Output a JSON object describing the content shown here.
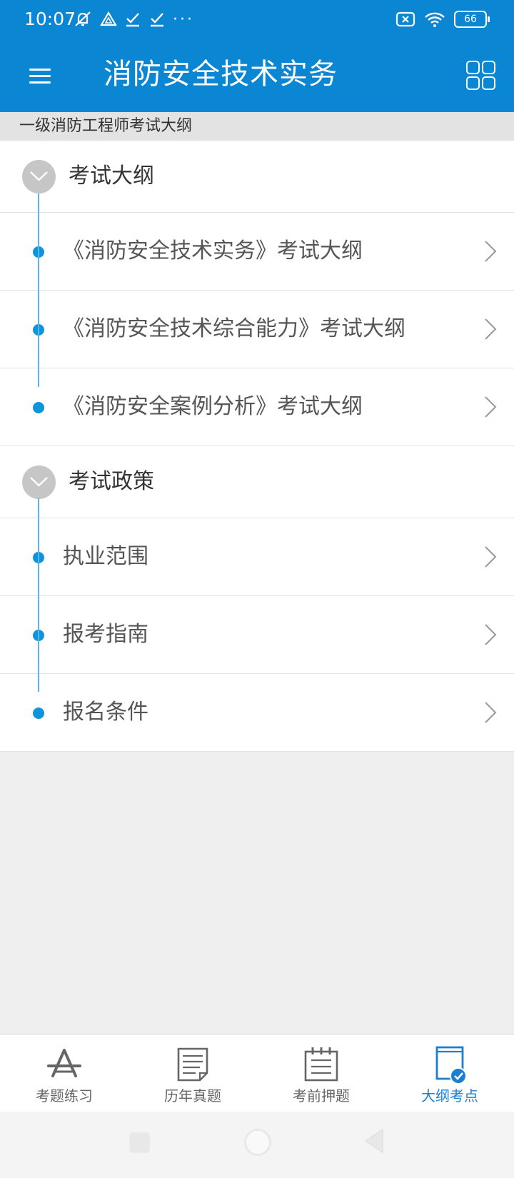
{
  "status_bar": {
    "time": "10:07",
    "battery": "66",
    "overflow": "···"
  },
  "app_bar": {
    "title": "消防安全技术实务"
  },
  "subheader": {
    "text": "一级消防工程师考试大纲"
  },
  "sections": [
    {
      "title": "考试大纲",
      "items": [
        "《消防安全技术实务》考试大纲",
        "《消防安全技术综合能力》考试大纲",
        "《消防安全案例分析》考试大纲"
      ]
    },
    {
      "title": "考试政策",
      "items": [
        "执业范围",
        "报考指南",
        "报名条件"
      ]
    }
  ],
  "tabs": [
    {
      "label": "考题练习",
      "icon": "practice-icon",
      "active": false
    },
    {
      "label": "历年真题",
      "icon": "past-papers-icon",
      "active": false
    },
    {
      "label": "考前押题",
      "icon": "predicted-questions-icon",
      "active": false
    },
    {
      "label": "大纲考点",
      "icon": "syllabus-icon",
      "active": true
    }
  ],
  "colors": {
    "primary": "#0a86d2",
    "timeline_dot": "#0c95dc",
    "active_tab": "#1a7fd0"
  }
}
